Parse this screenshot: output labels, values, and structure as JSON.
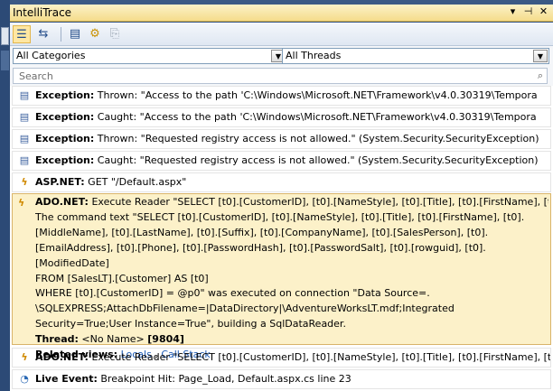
{
  "window": {
    "title": "IntelliTrace",
    "controls": [
      "▾",
      "⊣",
      "✕"
    ]
  },
  "toolbar": {
    "buttons": [
      {
        "name": "events-view-icon",
        "glyph": "☰"
      },
      {
        "name": "calls-view-icon",
        "glyph": "⇆"
      },
      {
        "name": "log-icon",
        "glyph": "▤"
      },
      {
        "name": "settings-icon",
        "glyph": "⚙"
      },
      {
        "name": "disabled-icon",
        "glyph": "⎘"
      }
    ]
  },
  "filters": {
    "categories": "All Categories",
    "threads": "All Threads"
  },
  "search": {
    "placeholder": "Search"
  },
  "events": [
    {
      "icon": "▤",
      "category": "Exception:",
      "text": " Thrown: \"Access to the path 'C:\\Windows\\Microsoft.NET\\Framework\\v4.0.30319\\Tempora"
    },
    {
      "icon": "▤",
      "category": "Exception:",
      "text": " Caught: \"Access to the path 'C:\\Windows\\Microsoft.NET\\Framework\\v4.0.30319\\Tempora"
    },
    {
      "icon": "▤",
      "category": "Exception:",
      "text": " Thrown: \"Requested registry access is not allowed.\" (System.Security.SecurityException)"
    },
    {
      "icon": "▤",
      "category": "Exception:",
      "text": " Caught: \"Requested registry access is not allowed.\" (System.Security.SecurityException)"
    },
    {
      "icon": "ϟ",
      "category": "ASP.NET:",
      "text": " GET \"/Default.aspx\""
    }
  ],
  "selected_event": {
    "category": "ADO.NET:",
    "summary": " Execute Reader \"SELECT [t0].[CustomerID], [t0].[NameStyle], [t0].[Title], [t0].[FirstName], [t0",
    "lines": [
      "The command text \"SELECT [t0].[CustomerID], [t0].[NameStyle], [t0].[Title], [t0].[FirstName], [t0].",
      "[MiddleName], [t0].[LastName], [t0].[Suffix], [t0].[CompanyName], [t0].[SalesPerson], [t0].",
      "[EmailAddress], [t0].[Phone], [t0].[PasswordHash], [t0].[PasswordSalt], [t0].[rowguid], [t0].",
      "[ModifiedDate]",
      "FROM [SalesLT].[Customer] AS [t0]",
      "WHERE [t0].[CustomerID] = @p0\" was executed on connection \"Data Source=.",
      "\\SQLEXPRESS;AttachDbFilename=|DataDirectory|\\AdventureWorksLT.mdf;Integrated",
      "Security=True;User Instance=True\", building a SqlDataReader."
    ],
    "thread_label": "Thread:",
    "thread_value": " <No Name> ",
    "thread_id": "[9804]",
    "related_label": "Related views:",
    "related_links": [
      "Locals",
      "Call Stack"
    ],
    "link_separator": " , "
  },
  "after_events": [
    {
      "icon": "ϟ",
      "category": "ADO.NET:",
      "text": " Execute Reader \"SELECT [t0].[CustomerID], [t0].[NameStyle], [t0].[Title], [t0].[FirstName], [t0"
    },
    {
      "icon": "◔",
      "category": "Live Event:",
      "text": " Breakpoint Hit: Page_Load, Default.aspx.cs line 23"
    }
  ]
}
